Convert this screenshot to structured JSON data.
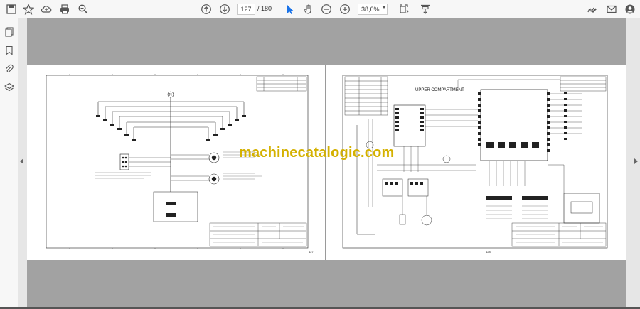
{
  "toolbar": {
    "current_page": "127",
    "page_total": "/ 180",
    "zoom": "38,6%",
    "icons": [
      "save-icon",
      "bookmark-star-icon",
      "cloud-upload-icon",
      "print-icon",
      "zoom-search-icon",
      "page-up-icon",
      "page-down-icon",
      "select-cursor-icon",
      "hand-icon",
      "zoom-out-icon",
      "zoom-in-icon",
      "fit-page-icon",
      "download-icon",
      "sign-icon",
      "mail-icon",
      "account-icon"
    ]
  },
  "sidebar": {
    "icons": [
      "pages-icon",
      "bookmark-icon",
      "attachment-icon",
      "layers-icon"
    ]
  },
  "document": {
    "watermark": "machinecatalogic.com",
    "left_page_number": "127",
    "right_page_number": "128",
    "upper_compartment_label": "UPPER COMPARTMENT",
    "left_node_label": "N",
    "colors": {
      "accent": "#1a73e8",
      "band": "#a2a2a2",
      "watermark": "#d4b100"
    }
  }
}
